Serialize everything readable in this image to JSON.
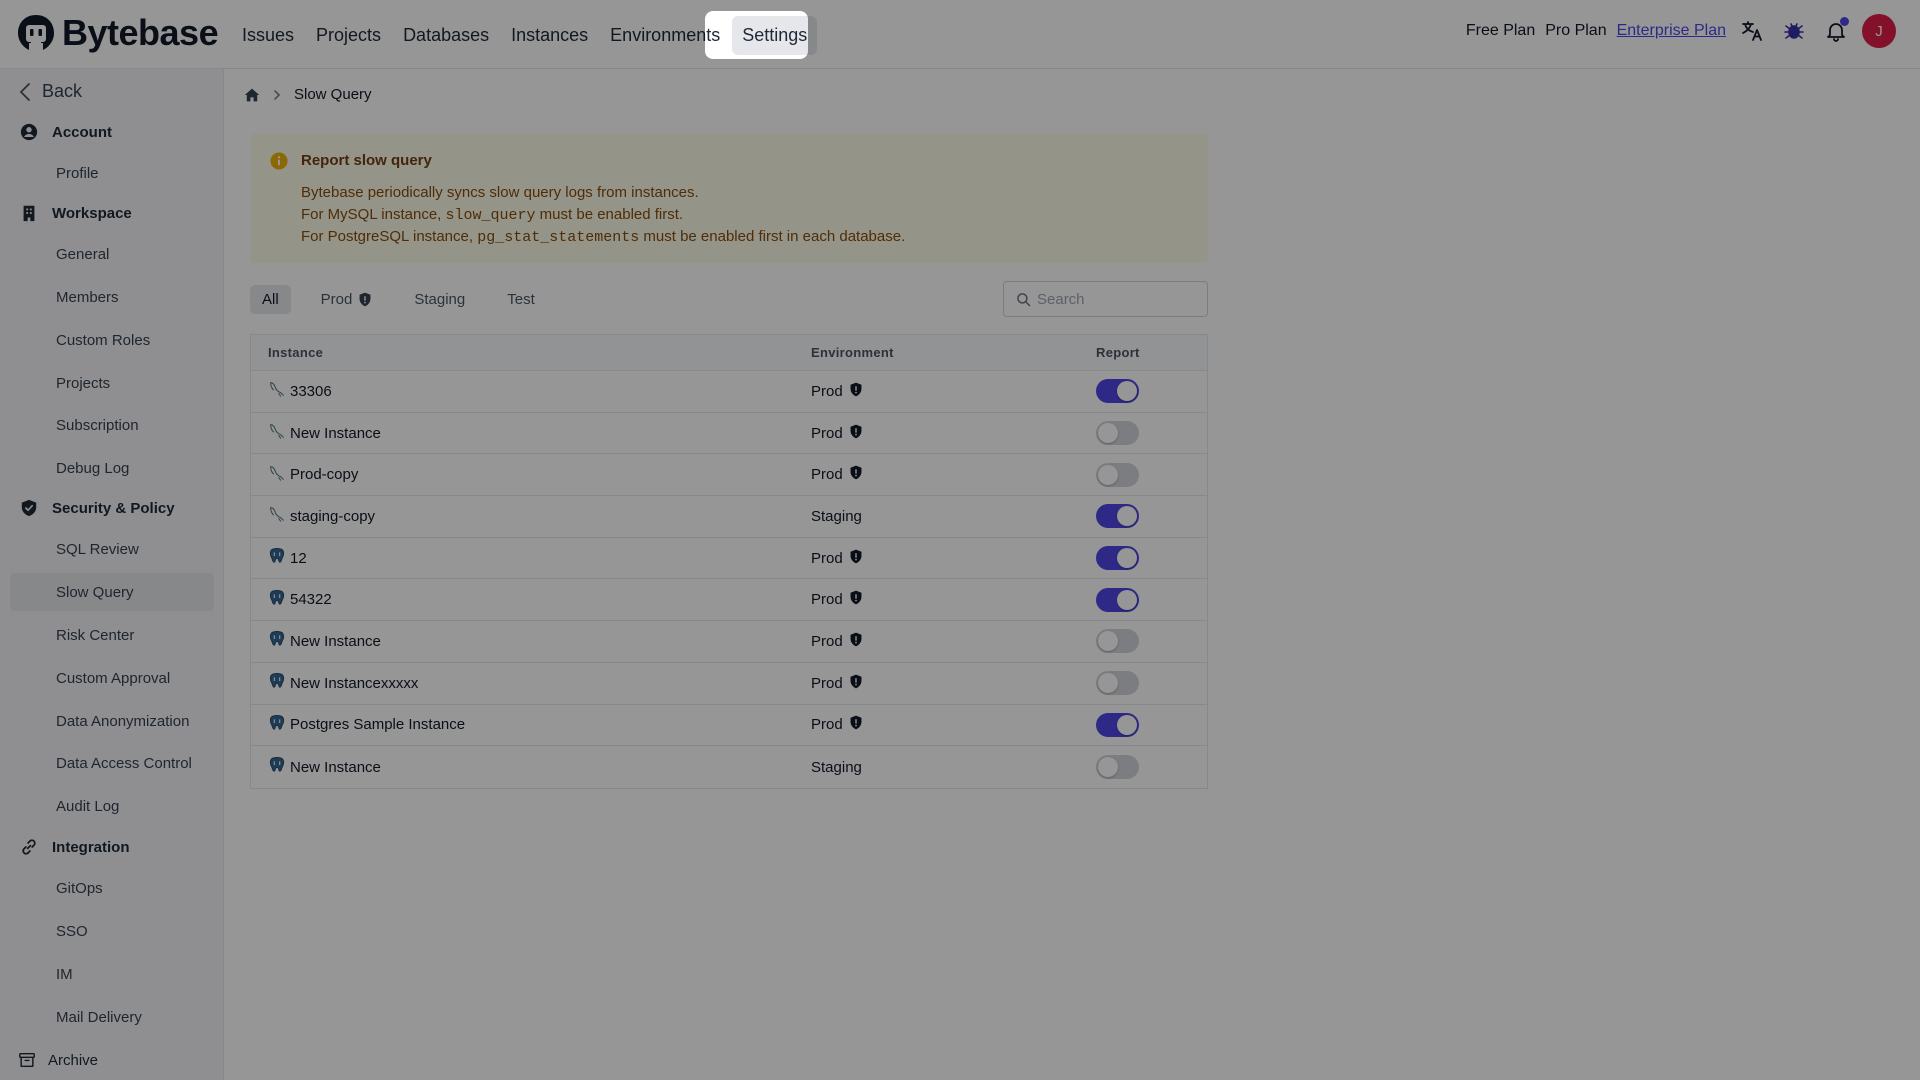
{
  "app": {
    "name": "Bytebase",
    "brand_color": "#4f46e5"
  },
  "topnav": {
    "items": [
      {
        "label": "Issues",
        "active": false
      },
      {
        "label": "Projects",
        "active": false
      },
      {
        "label": "Databases",
        "active": false
      },
      {
        "label": "Instances",
        "active": false
      },
      {
        "label": "Environments",
        "active": false
      },
      {
        "label": "Settings",
        "active": true
      }
    ],
    "plans": [
      "Free Plan",
      "Pro Plan",
      "Enterprise Plan"
    ],
    "icons": [
      "translate-icon",
      "bug-icon",
      "bell-icon"
    ],
    "avatar_initial": "J"
  },
  "sidebar": {
    "back_label": "Back",
    "groups": [
      {
        "label": "Account",
        "icon": "user-circle-icon",
        "items": [
          "Profile"
        ]
      },
      {
        "label": "Workspace",
        "icon": "building-icon",
        "items": [
          "General",
          "Members",
          "Custom Roles",
          "Projects",
          "Subscription",
          "Debug Log"
        ]
      },
      {
        "label": "Security & Policy",
        "icon": "shield-check-icon",
        "items": [
          "SQL Review",
          "Slow Query",
          "Risk Center",
          "Custom Approval",
          "Data Anonymization",
          "Data Access Control",
          "Audit Log"
        ]
      },
      {
        "label": "Integration",
        "icon": "link-icon",
        "items": [
          "GitOps",
          "SSO",
          "IM",
          "Mail Delivery"
        ]
      }
    ],
    "archive_label": "Archive",
    "active_item": "Slow Query"
  },
  "breadcrumb": {
    "current": "Slow Query"
  },
  "banner": {
    "title": "Report slow query",
    "line1": "Bytebase periodically syncs slow query logs from instances.",
    "line2_pre": "For MySQL instance, ",
    "line2_code": "slow_query",
    "line2_post": " must be enabled first.",
    "line3_pre": "For PostgreSQL instance, ",
    "line3_code": "pg_stat_statements",
    "line3_post": " must be enabled first in each database."
  },
  "filter_tabs": [
    {
      "label": "All",
      "active": true,
      "protected": false
    },
    {
      "label": "Prod",
      "active": false,
      "protected": true
    },
    {
      "label": "Staging",
      "active": false,
      "protected": false
    },
    {
      "label": "Test",
      "active": false,
      "protected": false
    }
  ],
  "search": {
    "placeholder": "Search",
    "value": ""
  },
  "table": {
    "columns": [
      "Instance",
      "Environment",
      "Report"
    ],
    "rows": [
      {
        "engine": "mysql",
        "instance": "33306",
        "environment": "Prod",
        "protected": true,
        "report": true
      },
      {
        "engine": "mysql",
        "instance": "New Instance",
        "environment": "Prod",
        "protected": true,
        "report": false
      },
      {
        "engine": "mysql",
        "instance": "Prod-copy",
        "environment": "Prod",
        "protected": true,
        "report": false
      },
      {
        "engine": "mysql",
        "instance": "staging-copy",
        "environment": "Staging",
        "protected": false,
        "report": true
      },
      {
        "engine": "postgres",
        "instance": "12",
        "environment": "Prod",
        "protected": true,
        "report": true
      },
      {
        "engine": "postgres",
        "instance": "54322",
        "environment": "Prod",
        "protected": true,
        "report": true
      },
      {
        "engine": "postgres",
        "instance": "New Instance",
        "environment": "Prod",
        "protected": true,
        "report": false
      },
      {
        "engine": "postgres",
        "instance": "New Instancexxxxx",
        "environment": "Prod",
        "protected": true,
        "report": false
      },
      {
        "engine": "postgres",
        "instance": "Postgres Sample Instance",
        "environment": "Prod",
        "protected": true,
        "report": true
      },
      {
        "engine": "postgres",
        "instance": "New Instance",
        "environment": "Staging",
        "protected": false,
        "report": false
      }
    ]
  }
}
